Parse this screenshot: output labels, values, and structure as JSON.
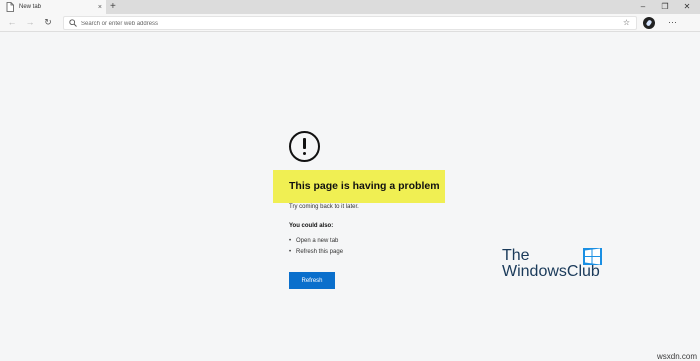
{
  "tab": {
    "title": "New tab",
    "close": "×"
  },
  "toolbar": {
    "newtab": "+",
    "minimize": "–",
    "maximize": "❐",
    "close": "✕",
    "back": "←",
    "forward": "→",
    "reload": "↻",
    "home": "⌂",
    "star": "☆",
    "menu": "···"
  },
  "address": {
    "placeholder": "Search or enter web address"
  },
  "error": {
    "title": "This page is having a problem",
    "subtitle": "Try coming back to it later.",
    "could_also": "You could also:",
    "suggestions": [
      "Open a new tab",
      "Refresh this page"
    ],
    "bullet": "•",
    "refresh_label": "Refresh",
    "accent_color": "#0a6fcc",
    "highlight_color": "#f0ef53"
  },
  "logo": {
    "line1": "The",
    "line2": "WindowsClub"
  },
  "watermark": "wsxdn.com",
  "icons": [
    "page-icon",
    "search-icon",
    "star-icon",
    "extension-icon",
    "error-icon",
    "windows-logo-icon"
  ]
}
